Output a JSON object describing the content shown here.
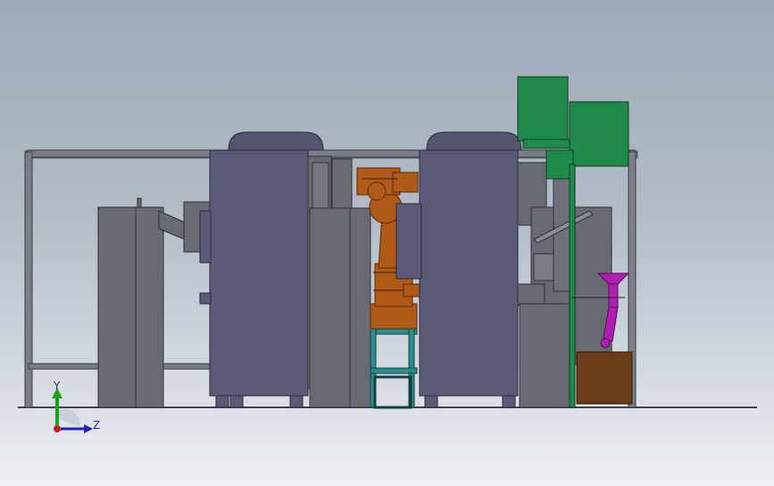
{
  "view": {
    "triad": {
      "y_label": "Y",
      "z_label": "Z",
      "colors": {
        "y_axis": "#20a020",
        "z_axis": "#2020c0",
        "origin": "#c02020"
      }
    }
  },
  "colors": {
    "frame": "#6e737c",
    "cabinet": "#5a5a78",
    "machine_grey": "#686b71",
    "robot": "#b05a18",
    "base_teal": "#2a8c8c",
    "hopper_green": "#1f8a4a",
    "magenta_chute": "#b020b0",
    "brown_bin": "#6b3d1a"
  }
}
